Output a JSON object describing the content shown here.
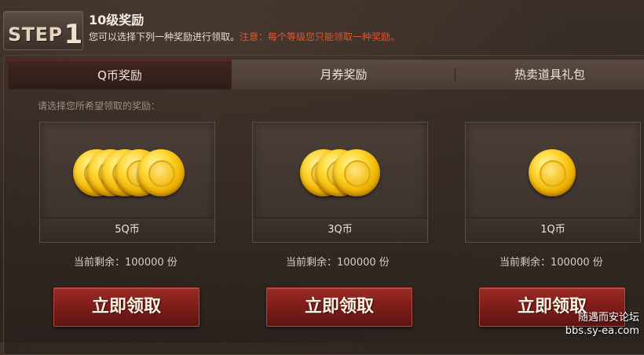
{
  "header": {
    "step_label": "STEP",
    "step_number": "1",
    "title": "10级奖励",
    "description": "您可以选择下列一种奖励进行领取。",
    "note": "注意：每个等级您只能领取一种奖励。"
  },
  "tabs": [
    {
      "label": "Q币奖励",
      "active": true
    },
    {
      "label": "月券奖励",
      "active": false
    },
    {
      "label": "热卖道具礼包",
      "active": false
    }
  ],
  "prompt": "请选择您所希望领取的奖励：",
  "rewards": [
    {
      "label": "5Q币",
      "stock": "当前剩余：100000 份",
      "button": "立即领取",
      "coin_count": 5
    },
    {
      "label": "3Q币",
      "stock": "当前剩余：100000 份",
      "button": "立即领取",
      "coin_count": 3
    },
    {
      "label": "1Q币",
      "stock": "当前剩余：100000 份",
      "button": "立即领取",
      "coin_count": 1
    }
  ],
  "watermark": {
    "line1": "随遇而安论坛",
    "line2": "bbs.sy-ea.com"
  },
  "colors": {
    "accent_red": "#8b221d",
    "note_red": "#e0552f",
    "coin_gold": "#f4c01c"
  }
}
